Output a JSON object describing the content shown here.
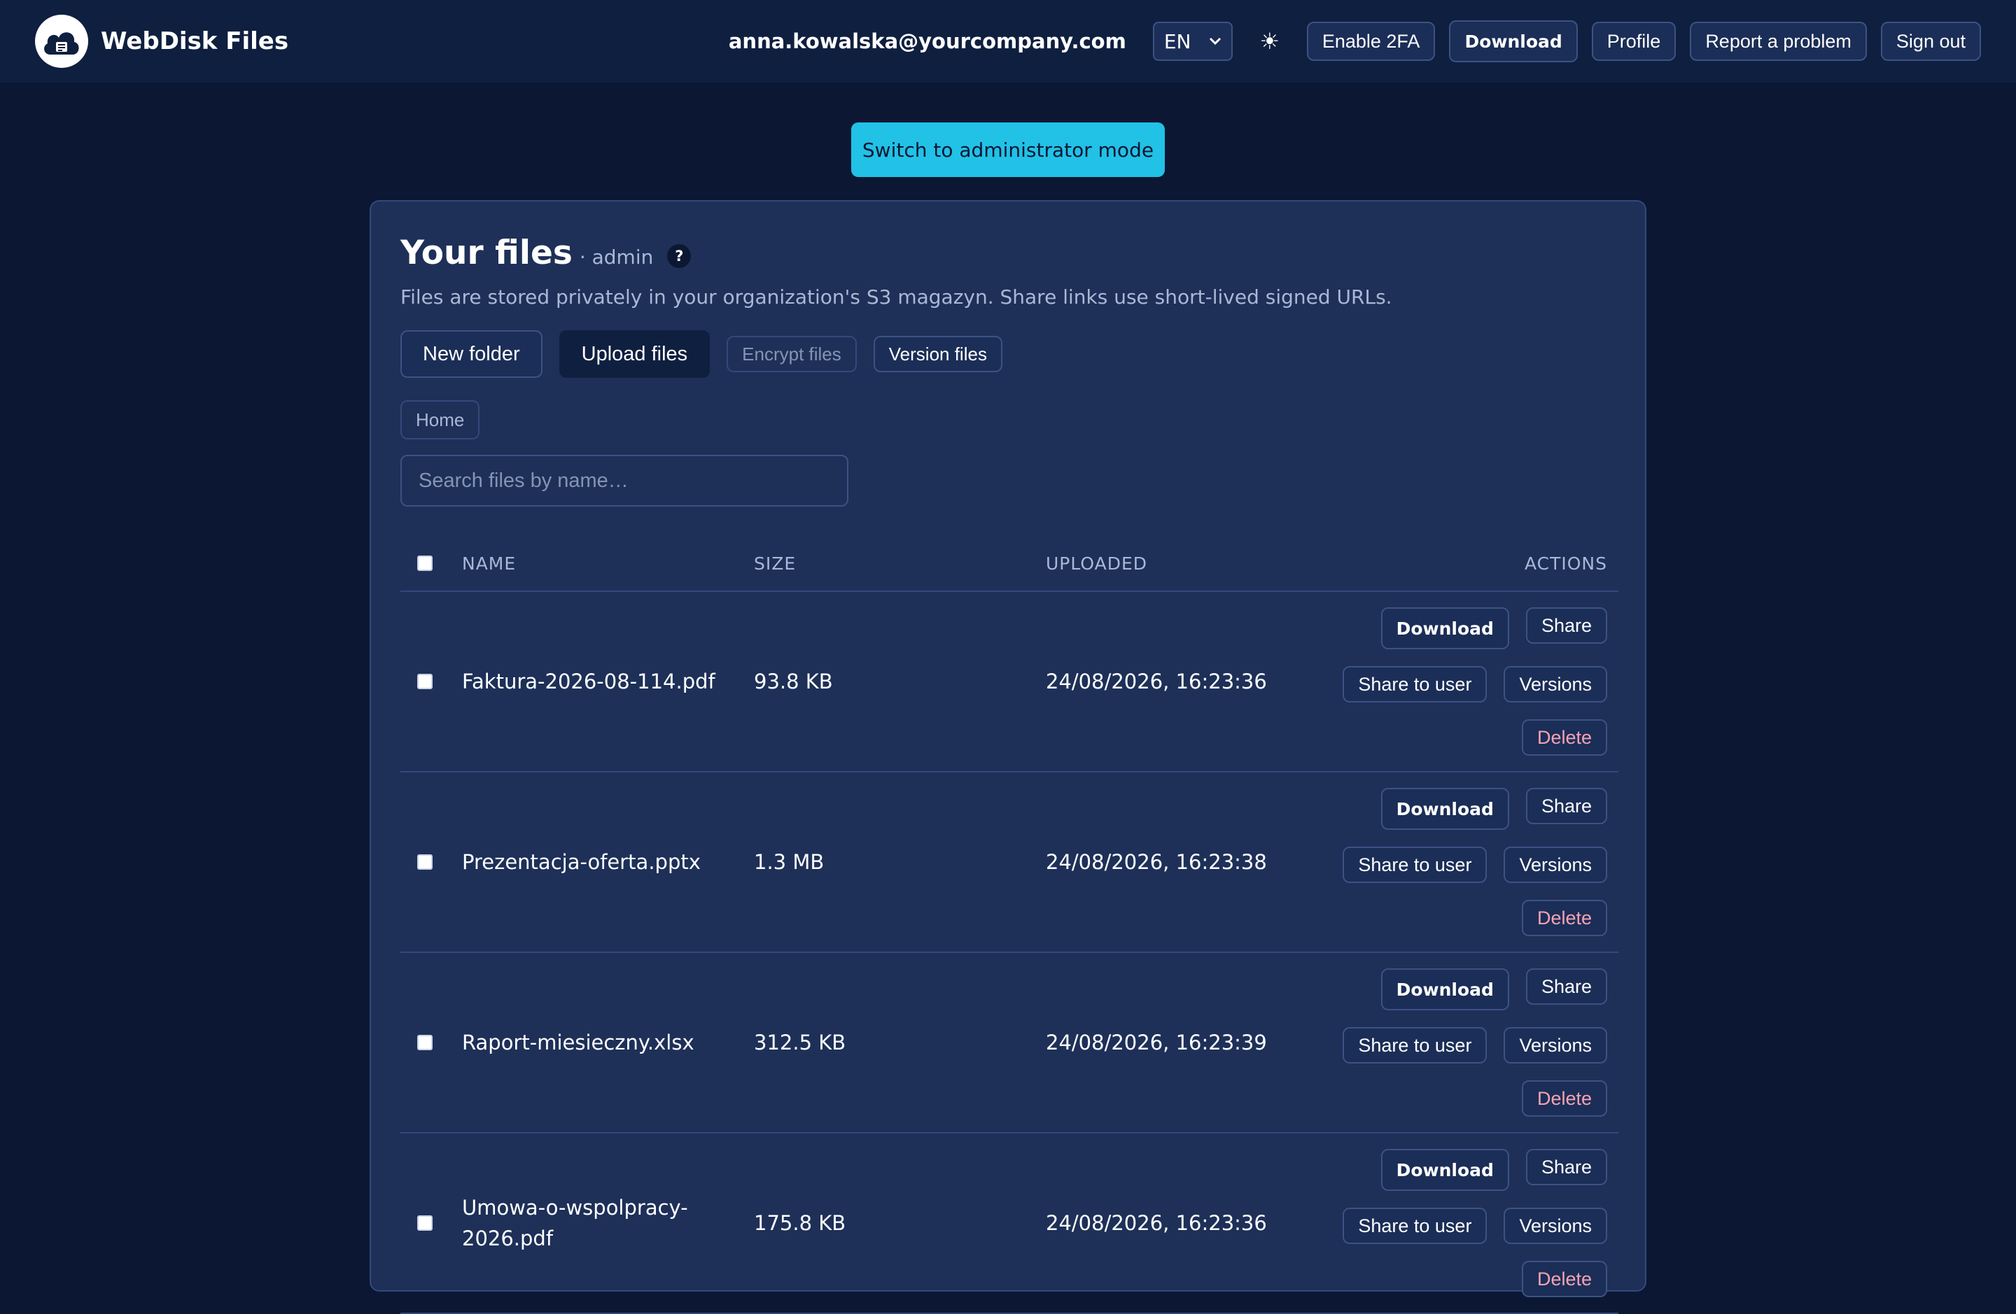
{
  "header": {
    "brand": "WebDisk Files",
    "user_email": "anna.kowalska@yourcompany.com",
    "language": "EN",
    "theme_icon": "☀",
    "buttons": {
      "enable_2fa": "Enable 2FA",
      "download": "Download",
      "profile": "Profile",
      "report": "Report a problem",
      "sign_out": "Sign out"
    }
  },
  "admin_switch": "Switch to administrator mode",
  "files_panel": {
    "title": "Your files",
    "role": "· admin",
    "help": "?",
    "description": "Files are stored privately in your organization's S3 magazyn. Share links use short-lived signed URLs.",
    "actions": {
      "new_folder": "New folder",
      "upload": "Upload files",
      "encrypt": "Encrypt files",
      "version": "Version files"
    },
    "breadcrumb": "Home",
    "search_placeholder": "Search files by name…",
    "columns": {
      "name": "NAME",
      "size": "SIZE",
      "uploaded": "UPLOADED",
      "actions": "ACTIONS"
    },
    "row_actions": {
      "download": "Download",
      "share": "Share",
      "share_to_user": "Share to user",
      "versions": "Versions",
      "delete": "Delete"
    },
    "files": [
      {
        "name": "Faktura-2026-08-114.pdf",
        "size": "93.8 KB",
        "uploaded": "24/08/2026, 16:23:36"
      },
      {
        "name": "Prezentacja-oferta.pptx",
        "size": "1.3 MB",
        "uploaded": "24/08/2026, 16:23:38"
      },
      {
        "name": "Raport-miesieczny.xlsx",
        "size": "312.5 KB",
        "uploaded": "24/08/2026, 16:23:39"
      },
      {
        "name": "Umowa-o-wspolpracy-2026.pdf",
        "size": "175.8 KB",
        "uploaded": "24/08/2026, 16:23:36"
      }
    ]
  }
}
